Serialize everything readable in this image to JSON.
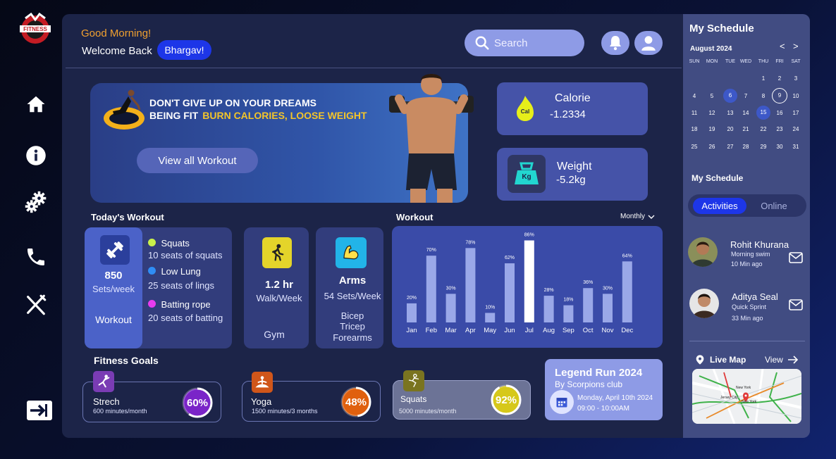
{
  "brand": {
    "logo_text": "FITNESS"
  },
  "header": {
    "greeting": "Good Morning!",
    "welcome": "Welcome Back",
    "user_name": "Bhargav!",
    "search_placeholder": "Search"
  },
  "banner": {
    "line1": "DON'T GIVE UP ON YOUR DREAMS",
    "line2_prefix": "BEING FIT",
    "line2_highlight": "BURN CALORIES, LOOSE WEIGHT",
    "button": "View all Workout"
  },
  "stats": {
    "calorie": {
      "title": "Calorie",
      "value": "-1.2334",
      "badge": "Cal"
    },
    "weight": {
      "title": "Weight",
      "value": "-5.2kg",
      "badge": "Kg"
    }
  },
  "today": {
    "title": "Today's Workout",
    "main": {
      "value": "850",
      "unit": "Sets/week",
      "label": "Workout"
    },
    "items": [
      {
        "name": "Squats",
        "desc": "10 seats of squats",
        "color": "#c8f04a"
      },
      {
        "name": "Low Lung",
        "desc": "25 seats of lings",
        "color": "#2f8df5"
      },
      {
        "name": "Batting rope",
        "desc": "20 seats of batting",
        "color": "#e83cf0"
      }
    ],
    "gym": {
      "value": "1.2 hr",
      "unit": "Walk/Week",
      "label": "Gym"
    },
    "arms": {
      "title": "Arms",
      "unit": "54 Sets/Week",
      "parts": [
        "Bicep",
        "Tricep",
        "Forearms"
      ]
    }
  },
  "workout_chart": {
    "title": "Workout",
    "period": "Monthly"
  },
  "chart_data": {
    "type": "bar",
    "categories": [
      "Jan",
      "Feb",
      "Mar",
      "Apr",
      "May",
      "Jun",
      "Jul",
      "Aug",
      "Sep",
      "Oct",
      "Nov",
      "Dec"
    ],
    "values": [
      20,
      70,
      30,
      78,
      10,
      62,
      86,
      28,
      18,
      36,
      30,
      64
    ],
    "labels": [
      "20%",
      "70%",
      "30%",
      "78%",
      "10%",
      "62%",
      "86%",
      "28%",
      "18%",
      "36%",
      "30%",
      "64%"
    ],
    "highlight_index": 6,
    "title": "Workout",
    "ylim": [
      0,
      100
    ]
  },
  "goals": {
    "title": "Fitness Goals",
    "items": [
      {
        "name": "Strech",
        "desc": "600 minutes/month",
        "percent": 60,
        "label": "60%",
        "color": "#7a24c8",
        "icon_bg": "#7a3cb4"
      },
      {
        "name": "Yoga",
        "desc": "1500 minutes/3 months",
        "percent": 48,
        "label": "48%",
        "color": "#e0600e",
        "icon_bg": "#d0561a"
      },
      {
        "name": "Squats",
        "desc": "5000 minutes/month",
        "percent": 92,
        "label": "92%",
        "color": "#d6c81a",
        "icon_bg": "#7a7420"
      }
    ]
  },
  "event": {
    "title": "Legend  Run 2024",
    "club": "By Scorpions club",
    "date": "Monday, April 10th 2024",
    "time": "09:00 - 10:00AM"
  },
  "schedule": {
    "title": "My Schedule",
    "month": "August 2024",
    "weekdays": [
      "SUN",
      "MON",
      "TUE",
      "WED",
      "THU",
      "FRI",
      "SAT"
    ],
    "weeks": [
      [
        "",
        "",
        "",
        "",
        "1",
        "2",
        "3"
      ],
      [
        "4",
        "5",
        "6",
        "7",
        "8",
        "9",
        "10"
      ],
      [
        "11",
        "12",
        "13",
        "14",
        "15",
        "16",
        "17"
      ],
      [
        "18",
        "19",
        "20",
        "21",
        "22",
        "23",
        "24"
      ],
      [
        "25",
        "26",
        "27",
        "28",
        "29",
        "30",
        "31"
      ]
    ],
    "subtitle": "My Schedule",
    "tab_active": "Activities",
    "tab_inactive": "Online",
    "people": [
      {
        "name": "Rohit Khurana",
        "activity": "Morning swim",
        "time": "10 Min ago"
      },
      {
        "name": "Aditya Seal",
        "activity": "Quick Sprint",
        "time": "33 Min ago"
      }
    ],
    "map_title": "Live Map",
    "map_view": "View",
    "map_label_1": "New York",
    "map_label_2": "New York",
    "map_label_3": "Jersey City"
  }
}
